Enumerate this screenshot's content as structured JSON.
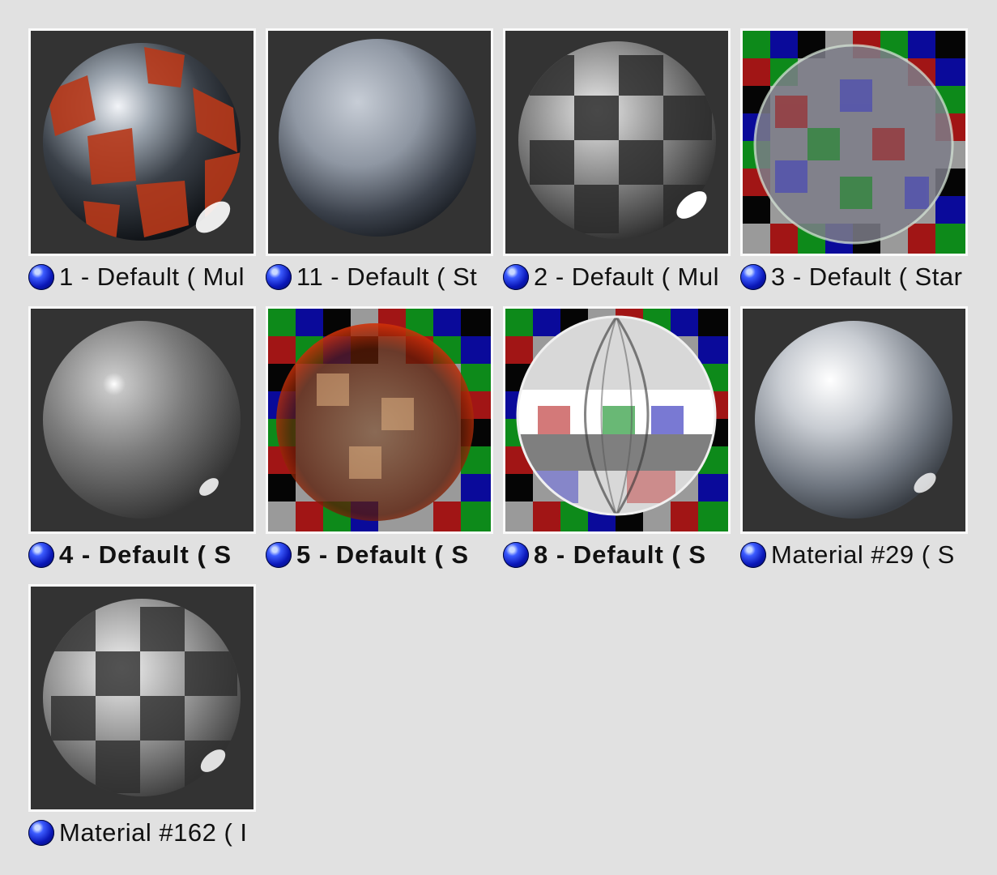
{
  "materials": [
    {
      "label": "1 - Default  ( Mul",
      "bold": false,
      "thumb": "red-checker-sphere"
    },
    {
      "label": "11 - Default  ( St",
      "bold": false,
      "thumb": "plain-gray-sphere"
    },
    {
      "label": "2 - Default  ( Mul",
      "bold": false,
      "thumb": "metal-checker-sphere"
    },
    {
      "label": "3 - Default  ( Star",
      "bold": false,
      "thumb": "glass-sphere-color-checker"
    },
    {
      "label": "4 - Default  ( S",
      "bold": true,
      "thumb": "shiny-gray-sphere"
    },
    {
      "label": "5 - Default  ( S",
      "bold": true,
      "thumb": "orange-glass-sphere-color-checker"
    },
    {
      "label": "8 - Default  ( S",
      "bold": true,
      "thumb": "chrome-sphere-color-checker"
    },
    {
      "label": "Material #29  ( S",
      "bold": false,
      "thumb": "brushed-silver-sphere"
    },
    {
      "label": "Material #162  ( I",
      "bold": false,
      "thumb": "grainy-checker-sphere"
    }
  ],
  "icons": {
    "material_type": "blue-sphere-icon"
  },
  "colors": {
    "background": "#e1e1e1",
    "thumb_bg": "#333333",
    "thumb_border": "#fafafa",
    "checker_red": "#a11515",
    "checker_green": "#0d8a1a",
    "checker_blue": "#0a0a9a",
    "checker_gray": "#9a9a9a",
    "checker_black": "#050505"
  }
}
